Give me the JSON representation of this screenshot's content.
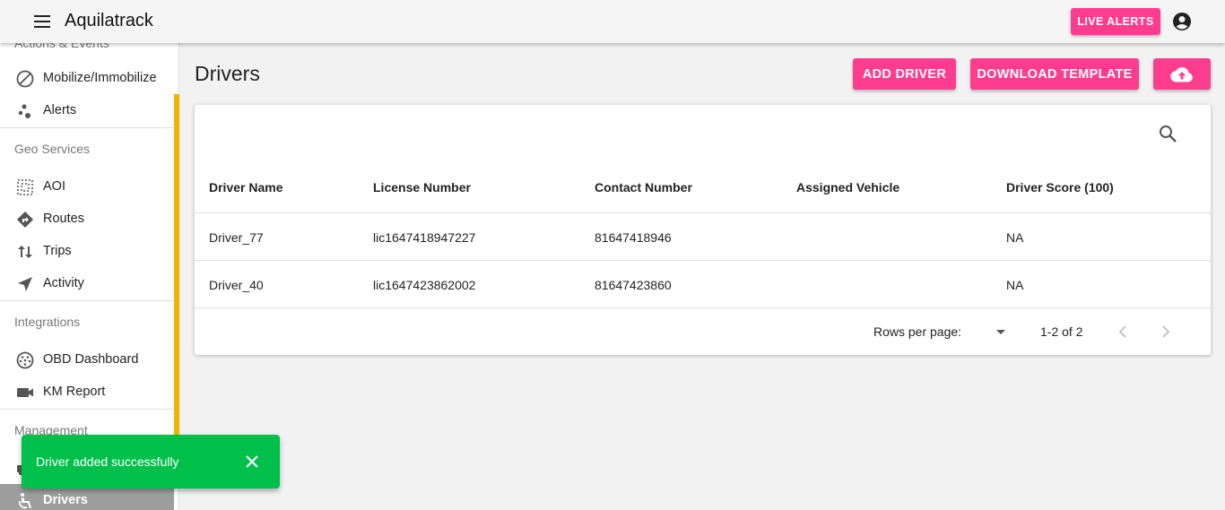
{
  "app": {
    "title": "Aquilatrack",
    "live_alerts_label": "LIVE ALERTS"
  },
  "sidebar": {
    "cut_section": "Actions & Events",
    "items_top": [
      {
        "label": "Mobilize/Immobilize",
        "icon": "block-icon"
      },
      {
        "label": "Alerts",
        "icon": "bubbles-icon"
      }
    ],
    "geo_section": "Geo Services",
    "geo_items": [
      {
        "label": "AOI",
        "icon": "area-select-icon"
      },
      {
        "label": "Routes",
        "icon": "directions-icon"
      },
      {
        "label": "Trips",
        "icon": "swap-vert-icon"
      },
      {
        "label": "Activity",
        "icon": "navigation-icon"
      }
    ],
    "integrations_section": "Integrations",
    "integration_items": [
      {
        "label": "OBD Dashboard",
        "icon": "obd-port-icon"
      },
      {
        "label": "KM Report",
        "icon": "video-camera-icon"
      }
    ],
    "management_section": "Management",
    "management_items": [
      {
        "label": "Drivers",
        "icon": "wheelchair-driver-icon",
        "active": true
      }
    ]
  },
  "main": {
    "title": "Drivers",
    "add_driver_label": "ADD DRIVER",
    "download_template_label": "DOWNLOAD TEMPLATE",
    "upload_icon": "cloud-upload-icon"
  },
  "table": {
    "columns": [
      "Driver Name",
      "License Number",
      "Contact Number",
      "Assigned Vehicle",
      "Driver Score (100)"
    ],
    "rows": [
      [
        "Driver_77",
        "lic1647418947227",
        "81647418946",
        "",
        "NA"
      ],
      [
        "Driver_40",
        "lic1647423862002",
        "81647423860",
        "",
        "NA"
      ]
    ],
    "rows_per_page_label": "Rows per page:",
    "pagination": "1-2 of 2"
  },
  "snackbar": {
    "message": "Driver added successfully"
  },
  "colors": {
    "accent": "#ff3d8e",
    "success": "#00c04b",
    "scrollbar": "#f0b400"
  }
}
